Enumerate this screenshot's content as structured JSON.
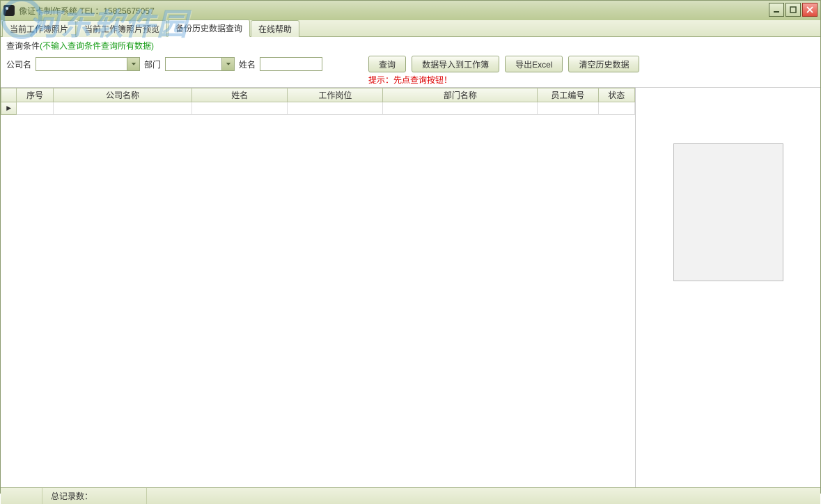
{
  "window": {
    "title": "像证卡制作系统 TEL：15825675057"
  },
  "tabs": [
    {
      "label": "当前工作簿照片"
    },
    {
      "label": "当前工作簿照片预览"
    },
    {
      "label": "备份历史数据查询"
    },
    {
      "label": "在线帮助"
    }
  ],
  "condition": {
    "label": "查询条件",
    "hint": "(不输入查询条件查询所有数据)"
  },
  "filters": {
    "company_label": "公司名",
    "company_value": "",
    "dept_label": "部门",
    "dept_value": "",
    "name_label": "姓名",
    "name_value": ""
  },
  "buttons": {
    "query": "查询",
    "import": "数据导入到工作簿",
    "export": "导出Excel",
    "clear": "清空历史数据"
  },
  "tip": "提示：先点查询按钮！",
  "columns": {
    "seq": "序号",
    "company": "公司名称",
    "name": "姓名",
    "position": "工作岗位",
    "dept": "部门名称",
    "empno": "员工编号",
    "status": "状态"
  },
  "status": {
    "total_label": "总记录数："
  },
  "watermark": "河东软件园"
}
